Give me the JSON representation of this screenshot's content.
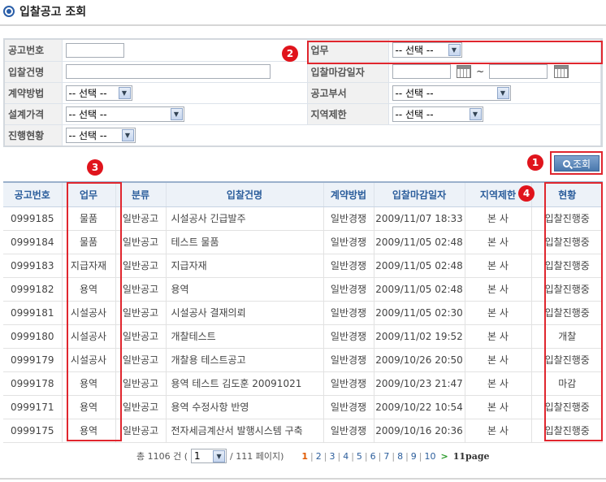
{
  "page": {
    "title": "입찰공고 조회"
  },
  "form": {
    "labels": {
      "notice_no": "공고번호",
      "business": "업무",
      "bid_name": "입찰건명",
      "deadline": "입찰마감일자",
      "contract_method": "계약방법",
      "dept": "공고부서",
      "design_price": "설계가격",
      "region": "지역제한",
      "progress": "진행현황"
    },
    "values": {
      "notice_no": "",
      "bid_name": "",
      "deadline_from": "",
      "deadline_to": "",
      "range_sep": "~"
    },
    "selects": {
      "business": "-- 선택 --",
      "contract_method": "-- 선택 --",
      "dept": "-- 선택 --",
      "design_price": "-- 선택 --",
      "region": "-- 선택 --",
      "progress": "-- 선택 --"
    },
    "search_label": "조회"
  },
  "badges": [
    "1",
    "2",
    "3",
    "4"
  ],
  "table": {
    "headers": [
      "공고번호",
      "업무",
      "분류",
      "입찰건명",
      "계약방법",
      "입찰마감일자",
      "지역제한",
      "현황"
    ],
    "rows": [
      [
        "0999185",
        "물품",
        "일반공고",
        "시설공사 긴급발주",
        "일반경쟁",
        "2009/11/07 18:33",
        "본 사",
        "입찰진행중"
      ],
      [
        "0999184",
        "물품",
        "일반공고",
        "테스트 물품",
        "일반경쟁",
        "2009/11/05 02:48",
        "본 사",
        "입찰진행중"
      ],
      [
        "0999183",
        "지급자재",
        "일반공고",
        "지급자재",
        "일반경쟁",
        "2009/11/05 02:48",
        "본 사",
        "입찰진행중"
      ],
      [
        "0999182",
        "용역",
        "일반공고",
        "용역",
        "일반경쟁",
        "2009/11/05 02:48",
        "본 사",
        "입찰진행중"
      ],
      [
        "0999181",
        "시설공사",
        "일반공고",
        "시설공사 결재의뢰",
        "일반경쟁",
        "2009/11/05 02:30",
        "본 사",
        "입찰진행중"
      ],
      [
        "0999180",
        "시설공사",
        "일반공고",
        "개찰테스트",
        "일반경쟁",
        "2009/11/02 19:52",
        "본 사",
        "개찰"
      ],
      [
        "0999179",
        "시설공사",
        "일반공고",
        "개찰용 테스트공고",
        "일반경쟁",
        "2009/10/26 20:50",
        "본 사",
        "입찰진행중"
      ],
      [
        "0999178",
        "용역",
        "일반공고",
        "용역 테스트 김도훈 20091021",
        "일반경쟁",
        "2009/10/23 21:47",
        "본 사",
        "마감"
      ],
      [
        "0999171",
        "용역",
        "일반공고",
        "용역 수정사항 반영",
        "일반경쟁",
        "2009/10/22 10:54",
        "본 사",
        "입찰진행중"
      ],
      [
        "0999175",
        "용역",
        "일반공고",
        "전자세금계산서 발행시스템 구축",
        "일반경쟁",
        "2009/10/16 20:36",
        "본 사",
        "입찰진행중"
      ]
    ]
  },
  "pager": {
    "total_prefix": "총 1106 건 (",
    "page_select": "1",
    "total_suffix": "/ 111 페이지)",
    "current": "1",
    "pages": [
      "2",
      "3",
      "4",
      "5",
      "6",
      "7",
      "8",
      "9",
      "10"
    ],
    "next": ">",
    "total_pages": "11page"
  },
  "colors": {
    "accent": "#2c5e9c",
    "highlight": "#e0262e",
    "button": "#4a78ad"
  }
}
